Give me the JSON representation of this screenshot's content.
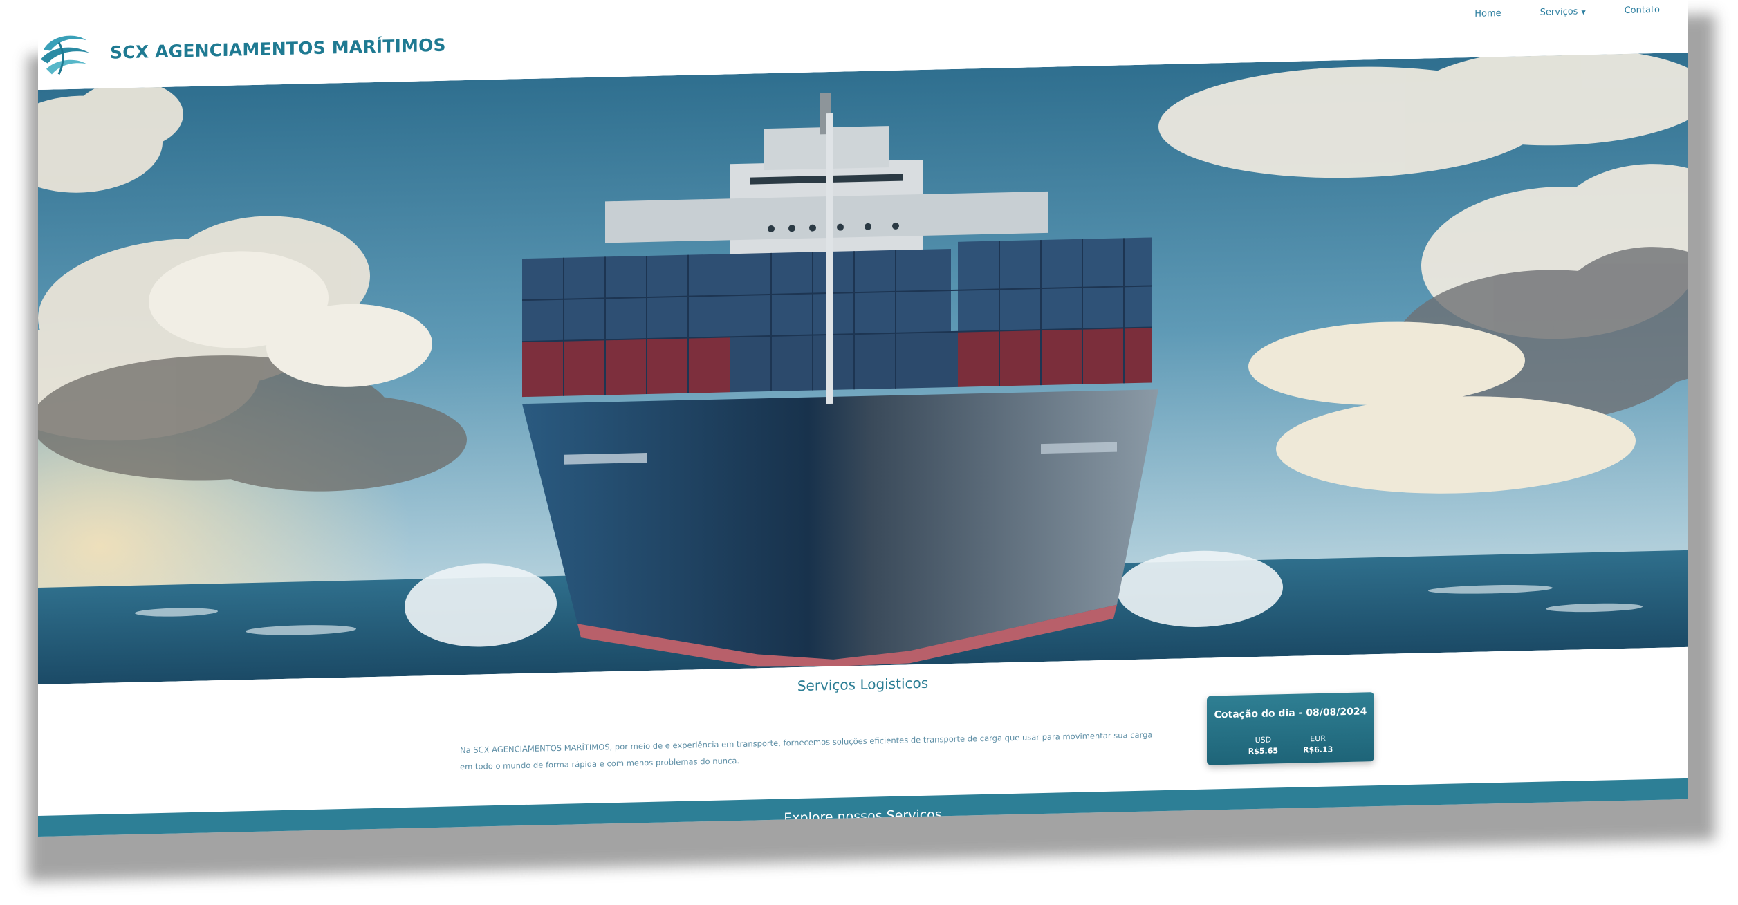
{
  "brand": {
    "name": "SCX AGENCIAMENTOS MARÍTIMOS",
    "logo_icon": "wave-logo-icon",
    "color": "#1f7a92"
  },
  "nav": {
    "items": [
      {
        "label": "Home"
      },
      {
        "label": "Serviços",
        "has_dropdown": true
      },
      {
        "label": "Contato"
      }
    ]
  },
  "hero": {
    "image": "container-ship-at-sea"
  },
  "services": {
    "title": "Serviços Logisticos",
    "description": "Na SCX AGENCIAMENTOS MARÍTIMOS, por meio de e experiência em transporte, fornecemos soluções eficientes de transporte de carga que usar para movimentar sua carga em todo o mundo de forma rápida e com menos problemas do nunca."
  },
  "exchange": {
    "title": "Cotação do dia - 08/08/2024",
    "rates": [
      {
        "currency": "USD",
        "value": "R$5.65"
      },
      {
        "currency": "EUR",
        "value": "R$6.13"
      }
    ]
  },
  "cta": {
    "label": "Explore nossos Serviços",
    "color": "#2d7f96"
  }
}
